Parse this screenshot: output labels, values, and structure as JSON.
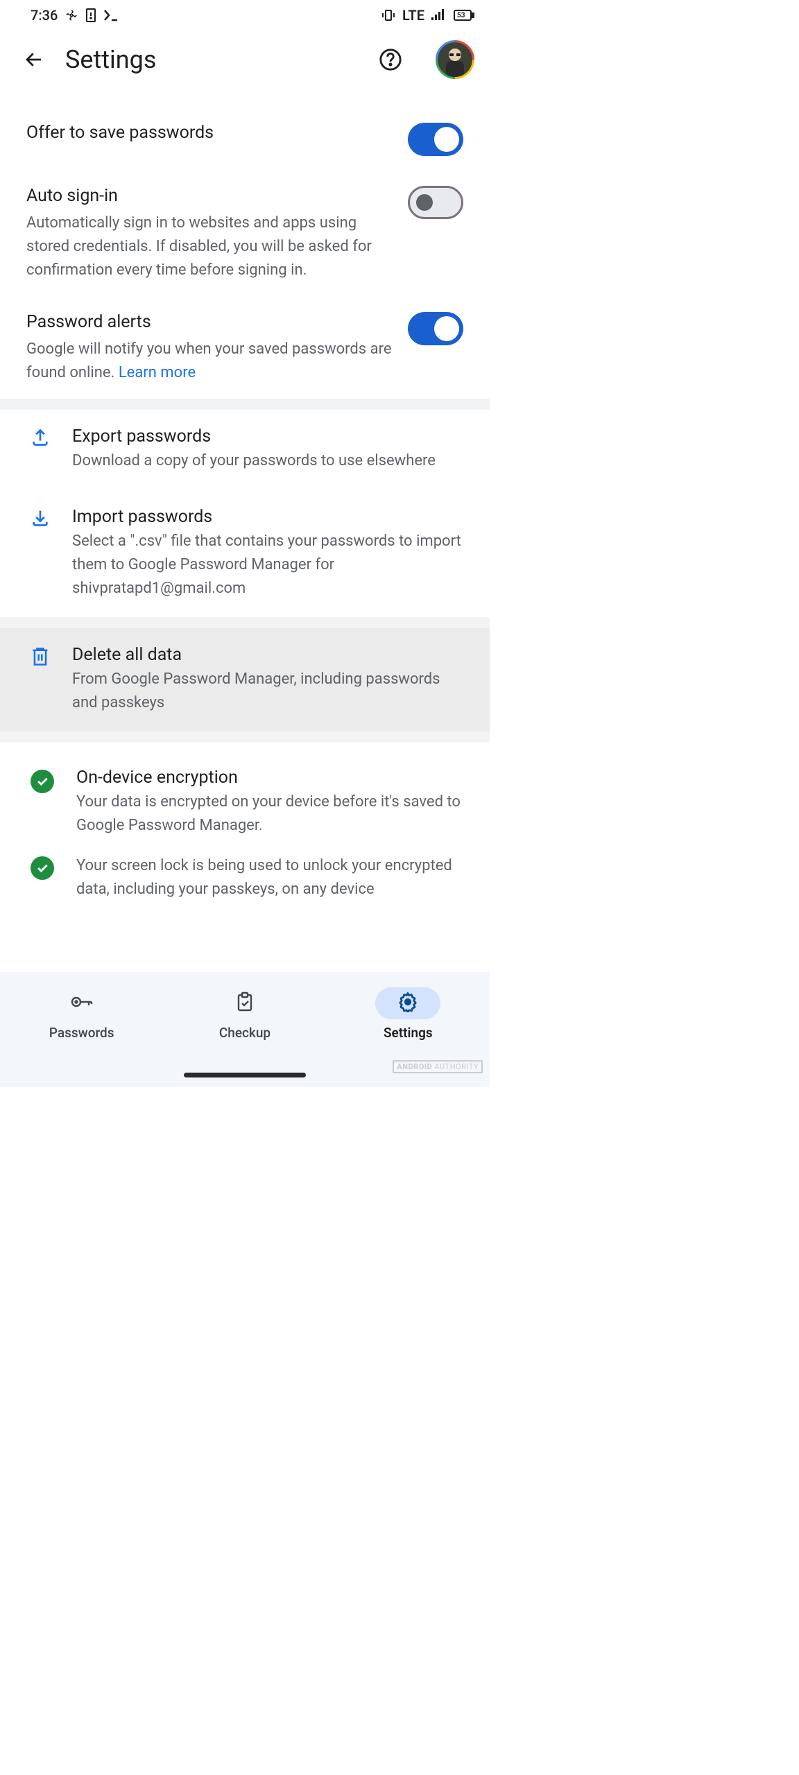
{
  "statusbar": {
    "time": "7:36",
    "network": "LTE",
    "battery": "53"
  },
  "header": {
    "title": "Settings"
  },
  "settings": {
    "offer_save": {
      "title": "Offer to save passwords"
    },
    "auto_signin": {
      "title": "Auto sign-in",
      "desc": "Automatically sign in to websites and apps using stored credentials. If disabled, you will be asked for confirmation every time before signing in."
    },
    "password_alerts": {
      "title": "Password alerts",
      "desc": "Google will notify you when your saved passwords are found online. ",
      "link": "Learn more"
    }
  },
  "actions": {
    "export": {
      "title": "Export passwords",
      "desc": "Download a copy of your passwords to use elsewhere"
    },
    "import": {
      "title": "Import passwords",
      "desc": "Select a \".csv\" file that contains your passwords to import them to Google Password Manager for shivpratapd1@gmail.com"
    },
    "delete": {
      "title": "Delete all data",
      "desc": "From Google Password Manager, including passwords and passkeys"
    },
    "encryption": {
      "title": "On-device encryption",
      "desc": "Your data is encrypted on your device before it's saved to Google Password Manager."
    },
    "screenlock": {
      "desc": "Your screen lock is being used to unlock your encrypted data, including your passkeys, on any device"
    }
  },
  "nav": {
    "passwords": "Passwords",
    "checkup": "Checkup",
    "settings": "Settings"
  },
  "watermark": {
    "brand": "ANDROID",
    "site": "AUTHORITY"
  }
}
